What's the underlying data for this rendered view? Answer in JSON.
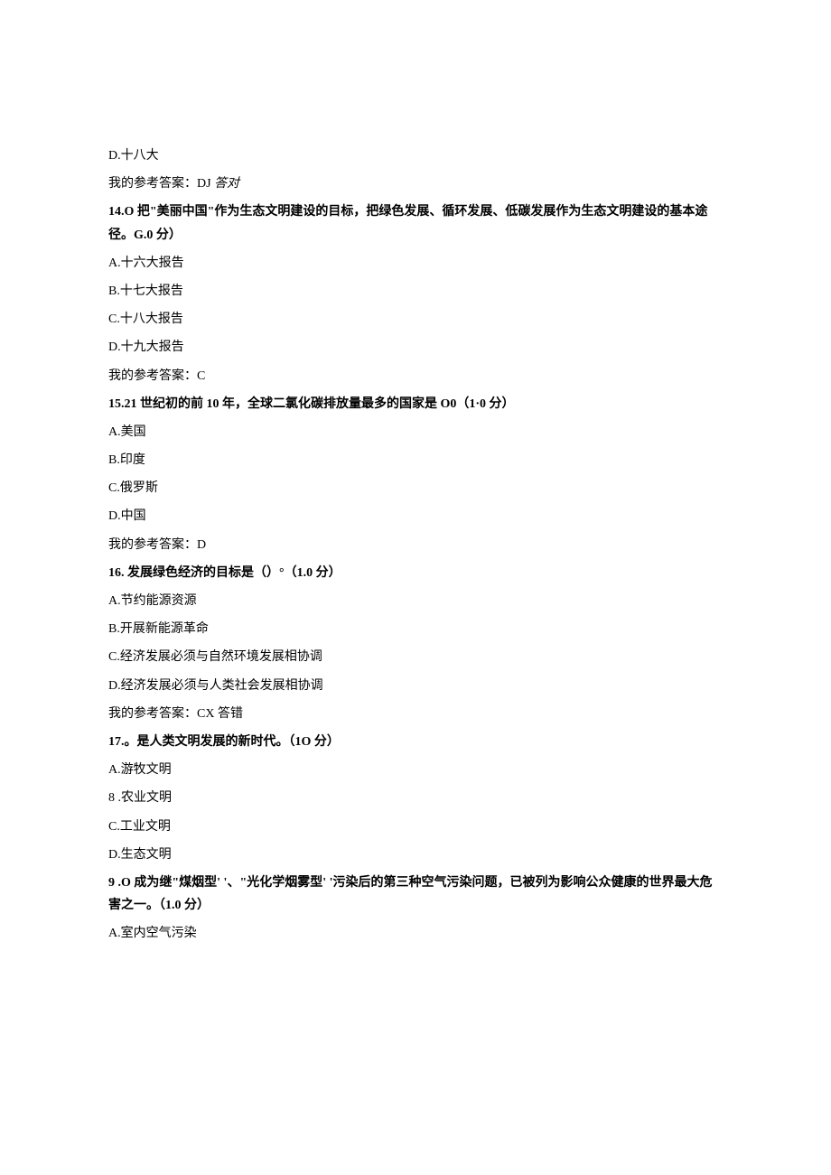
{
  "q13": {
    "optionD": "D.十八大",
    "answer_prefix": "我的参考答案：DJ ",
    "answer_suffix": "答对"
  },
  "q14": {
    "stem": "14.O 把\"美丽中国\"作为生态文明建设的目标，把绿色发展、循环发展、低碳发展作为生态文明建设的基本途径。G.0 分）",
    "optionA": "A.十六大报告",
    "optionB": "B.十七大报告",
    "optionC": "C.十八大报告",
    "optionD": "D.十九大报告",
    "answer": "我的参考答案：C"
  },
  "q15": {
    "stem": "15.21 世纪初的前 10 年，全球二氯化碳排放量最多的国家是 O0（1·0 分）",
    "optionA": "A.美国",
    "optionB": "B.印度",
    "optionC": "C.俄罗斯",
    "optionD": "D.中国",
    "answer": "我的参考答案：D"
  },
  "q16": {
    "stem": "16. 发展绿色经济的目标是（）°（1.0 分）",
    "optionA": "A.节约能源资源",
    "optionB": "B.开展新能源革命",
    "optionC": "C.经济发展必须与自然环境发展相协调",
    "optionD": "D.经济发展必须与人类社会发展相协调",
    "answer": "我的参考答案：CX 答错"
  },
  "q17": {
    "stem": "17.。是人类文明发展的新时代。（1O 分）",
    "optionA": "A.游牧文明",
    "optionB": "8   .农业文明",
    "optionC": "C.工业文明",
    "optionD": "D.生态文明"
  },
  "q18": {
    "stem": "9   .O 成为继\"煤烟型' '、\"光化学烟雾型' '污染后的第三种空气污染问题，已被列为影响公众健康的世界最大危害之一。（1.0 分）",
    "optionA": "A.室内空气污染"
  }
}
